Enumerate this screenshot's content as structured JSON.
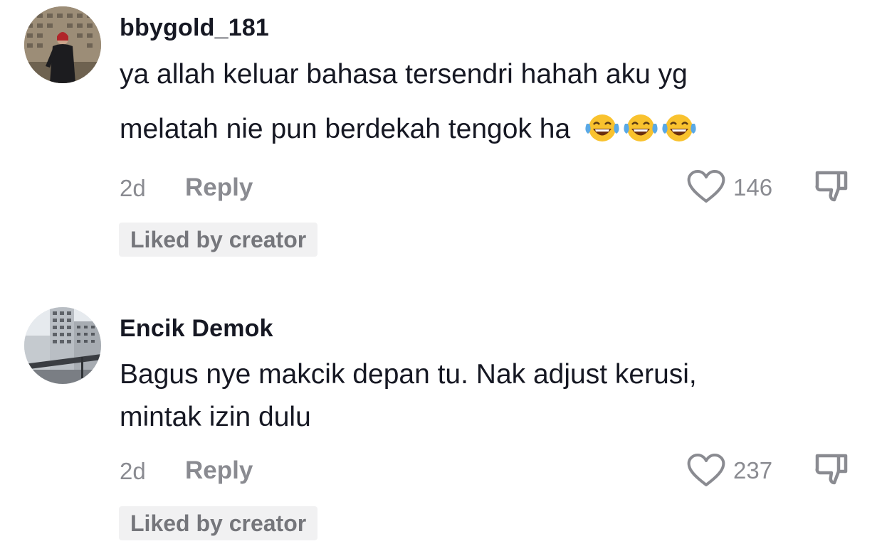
{
  "comments": [
    {
      "username": "bbygold_181",
      "text_line1": "ya allah keluar bahasa tersendri hahah aku yg",
      "text_line2": "melatah nie pun berdekah tengok ha",
      "emoji": "😂😂😂",
      "time": "2d",
      "reply_label": "Reply",
      "likes": "146",
      "badge": "Liked by creator"
    },
    {
      "username": "Encik Demok",
      "text_line1": "Bagus nye makcik depan tu. Nak adjust kerusi,",
      "text_line2": "mintak izin dulu",
      "time": "2d",
      "reply_label": "Reply",
      "likes": "237",
      "badge": "Liked by creator"
    }
  ],
  "colors": {
    "text_primary": "#161823",
    "text_secondary": "#8a8b91",
    "badge_bg": "#f1f1f2",
    "badge_text": "#75767b"
  },
  "icons": [
    "avatar-photo",
    "heart-icon",
    "dislike-icon",
    "laughing-crying-emoji"
  ]
}
